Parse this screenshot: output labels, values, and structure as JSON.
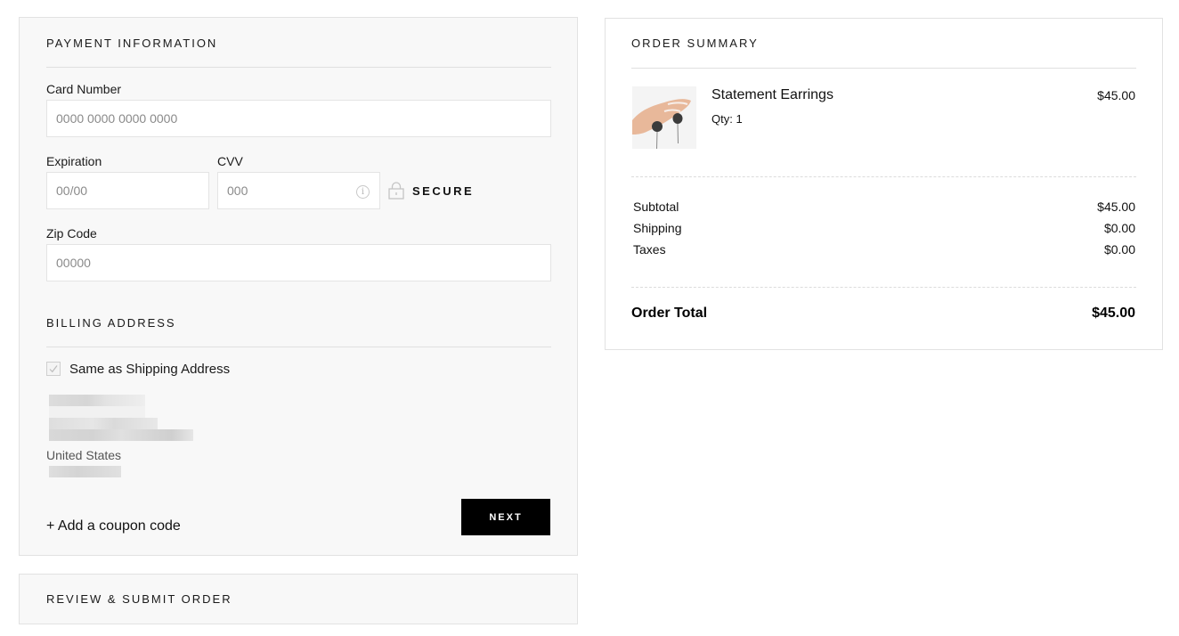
{
  "payment": {
    "title": "Payment Information",
    "card_number": {
      "label": "Card Number",
      "value": "",
      "placeholder": "0000 0000 0000 0000"
    },
    "expiration": {
      "label": "Expiration",
      "value": "",
      "placeholder": "00/00"
    },
    "cvv": {
      "label": "CVV",
      "value": "",
      "placeholder": "000",
      "info_icon": "info-icon"
    },
    "secure": {
      "icon": "lock-icon",
      "label": "SECURE"
    },
    "zip": {
      "label": "Zip Code",
      "value": "",
      "placeholder": "00000"
    }
  },
  "billing": {
    "title": "Billing Address",
    "same_as_shipping": {
      "label": "Same as Shipping Address",
      "checked": true
    },
    "address_country": "United States",
    "address_redacted": true
  },
  "actions": {
    "coupon_label": "+ Add a coupon code",
    "next_label": "NEXT"
  },
  "review": {
    "title": "Review & Submit Order"
  },
  "summary": {
    "title": "Order Summary",
    "items": [
      {
        "name": "Statement Earrings",
        "qty_label": "Qty: 1",
        "price": "$45.00",
        "image": "earrings-product-photo"
      }
    ],
    "rows": [
      {
        "label": "Subtotal",
        "value": "$45.00"
      },
      {
        "label": "Shipping",
        "value": "$0.00"
      },
      {
        "label": "Taxes",
        "value": "$0.00"
      }
    ],
    "total": {
      "label": "Order Total",
      "value": "$45.00"
    }
  },
  "colors": {
    "panel_bg": "#f8f8f8",
    "border": "#e2e2e2",
    "button_bg": "#000000",
    "button_text": "#ffffff"
  }
}
